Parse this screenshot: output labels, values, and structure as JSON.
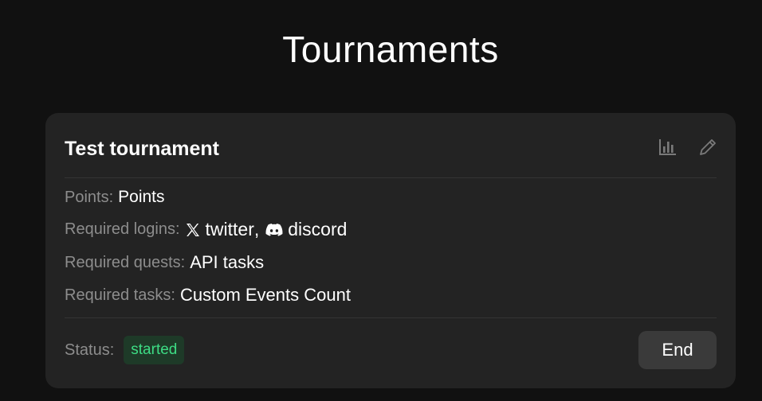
{
  "page": {
    "title": "Tournaments"
  },
  "tournament": {
    "name": "Test tournament",
    "actions": {
      "stats_icon": "bar-chart-icon",
      "edit_icon": "pencil-icon"
    },
    "points": {
      "label": "Points:",
      "value": "Points"
    },
    "required_logins": {
      "label": "Required logins:",
      "items": [
        {
          "icon": "x-twitter-icon",
          "name": "twitter"
        },
        {
          "icon": "discord-icon",
          "name": "discord"
        }
      ],
      "separator": ","
    },
    "required_quests": {
      "label": "Required quests:",
      "value": "API tasks"
    },
    "required_tasks": {
      "label": "Required tasks:",
      "value": "Custom Events Count"
    },
    "status": {
      "label": "Status:",
      "value": "started",
      "color": "#3ddc84",
      "bg": "#1e3a28"
    },
    "end_button": {
      "label": "End"
    }
  },
  "colors": {
    "background": "#111111",
    "card": "#232323",
    "muted_text": "#8d8d8d",
    "button": "#3a3a3a"
  }
}
